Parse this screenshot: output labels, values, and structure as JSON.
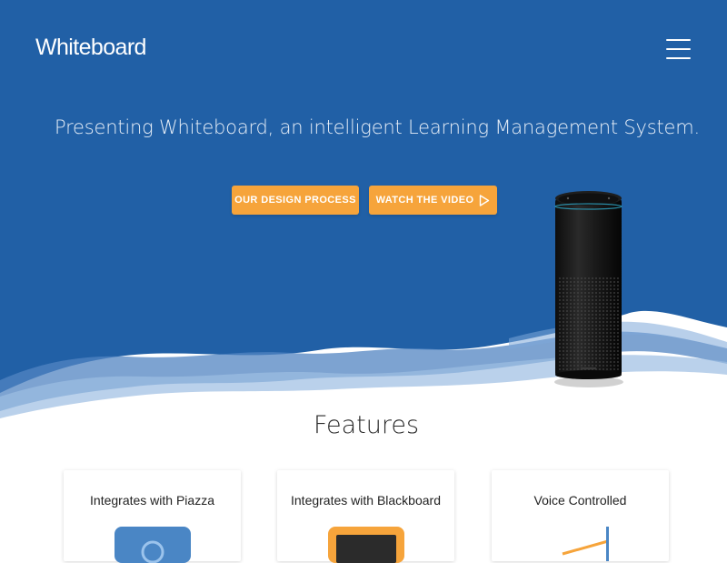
{
  "header": {
    "logo": "Whiteboard",
    "menu_icon": "hamburger-menu-icon"
  },
  "hero": {
    "tagline": "Presenting Whiteboard, an intelligent Learning Management System.",
    "buttons": [
      {
        "label": "OUR DESIGN PROCESS"
      },
      {
        "label": "WATCH THE VIDEO",
        "icon": "play-icon"
      }
    ],
    "product_image": "smart-speaker-image"
  },
  "features": {
    "title": "Features",
    "cards": [
      {
        "title": "Integrates with Piazza",
        "icon": "piazza-app-icon"
      },
      {
        "title": "Integrates with Blackboard",
        "icon": "blackboard-app-icon"
      },
      {
        "title": "Voice Controlled",
        "icon": "voice-wave-icon"
      }
    ]
  },
  "colors": {
    "hero_bg": "#2160a6",
    "button_bg": "#f6a43b",
    "text_dark": "#222222",
    "white": "#ffffff"
  }
}
